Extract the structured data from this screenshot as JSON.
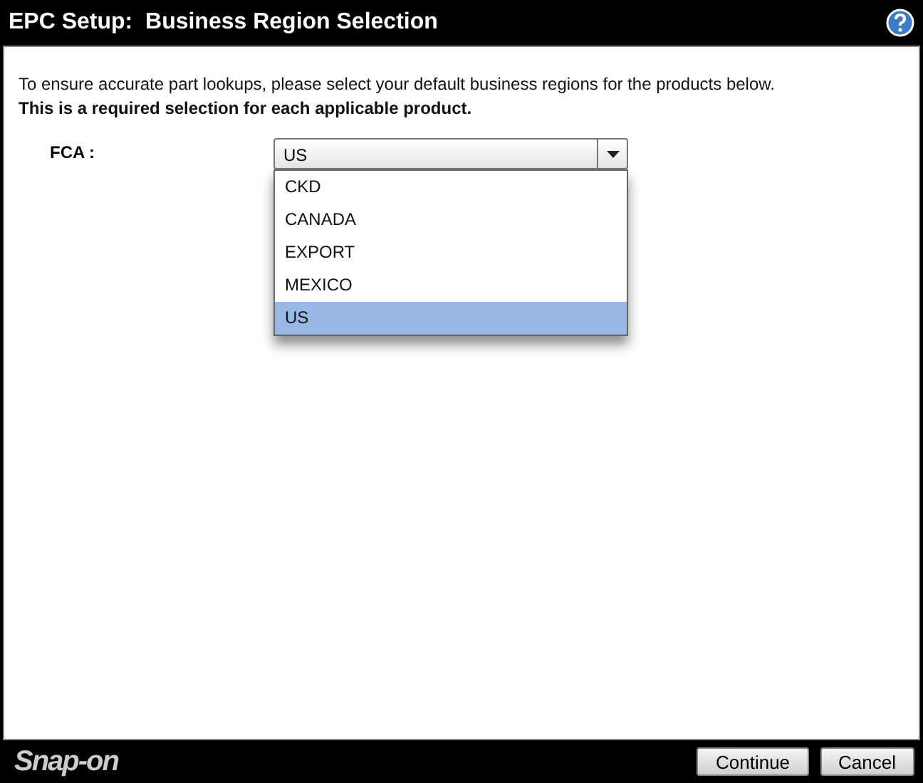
{
  "window": {
    "title": "EPC Setup:  Business Region Selection"
  },
  "intro": "To ensure accurate part lookups, please select your default business regions for the products below.",
  "requirement": "This is a required selection for each applicable product.",
  "field": {
    "label": "FCA :",
    "value": "US",
    "expanded": true
  },
  "options": [
    {
      "label": "CKD",
      "selected": false
    },
    {
      "label": "CANADA",
      "selected": false
    },
    {
      "label": "EXPORT",
      "selected": false
    },
    {
      "label": "MEXICO",
      "selected": false
    },
    {
      "label": "US",
      "selected": true
    }
  ],
  "footer": {
    "logo": "Snap-on",
    "buttons": [
      "Continue",
      "Cancel"
    ]
  }
}
